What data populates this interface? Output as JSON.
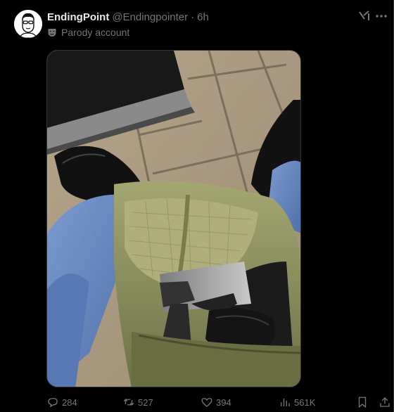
{
  "post": {
    "display_name": "EndingPoint",
    "handle": "@Endingpointer",
    "separator": "·",
    "timestamp": "6h",
    "label": "Parody account"
  },
  "icons": {
    "header": [
      "grok-icon",
      "more-icon"
    ],
    "label": "parody-mask-icon",
    "actions": [
      "reply-icon",
      "repost-icon",
      "like-icon",
      "views-icon",
      "bookmark-icon",
      "share-icon"
    ]
  },
  "actions": {
    "replies": "284",
    "reposts": "527",
    "likes": "394",
    "views": "561K"
  },
  "colors": {
    "background": "#000000",
    "text_primary": "#e7e9ea",
    "text_secondary": "#71767b",
    "divider": "#2f3336"
  }
}
